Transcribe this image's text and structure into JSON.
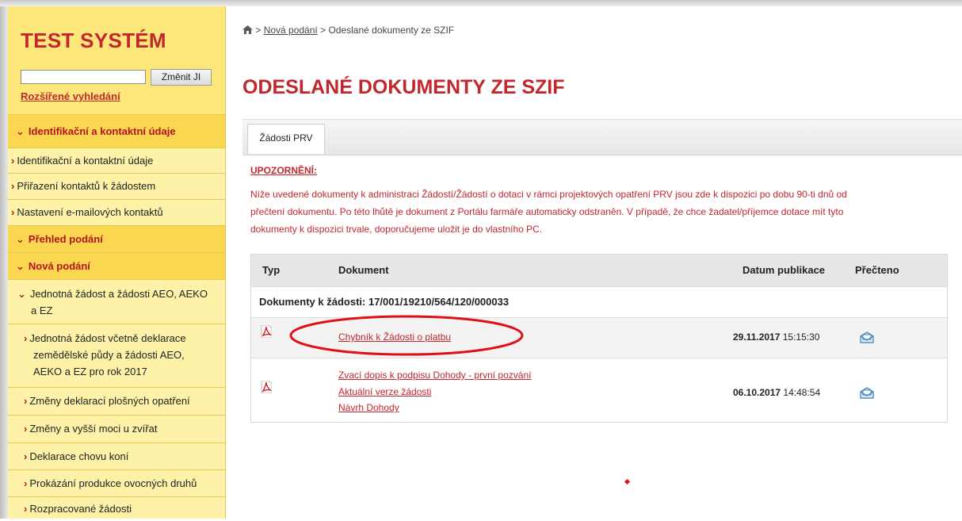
{
  "sidebar": {
    "brand": "TEST SYSTÉM",
    "search_value": "",
    "search_button": "Změnit JI",
    "advanced_search": "Rozšířené vyhledání",
    "items": [
      {
        "label": "Identifikační a kontaktní údaje",
        "kind": "section"
      },
      {
        "label": "Identifikační a kontaktní údaje",
        "kind": "item"
      },
      {
        "label": "Přiřazení kontaktů k žádostem",
        "kind": "item"
      },
      {
        "label": "Nastavení e-mailových kontaktů",
        "kind": "item"
      },
      {
        "label": "Přehled podání",
        "kind": "section"
      },
      {
        "label": "Nová podání",
        "kind": "section"
      },
      {
        "label_line1": "Jednotná žádost a žádosti AEO, AEKO",
        "label_line2": "a EZ",
        "kind": "subsection"
      },
      {
        "label_line1": "Jednotná žádost včetně deklarace",
        "label_line2": "zemědělské půdy a žádosti AEO,",
        "label_line3": "AEKO a EZ pro rok 2017",
        "kind": "subitem"
      },
      {
        "label": "Změny deklarací plošných opatření",
        "kind": "subitem"
      },
      {
        "label": "Změny a vyšší moci u zvířat",
        "kind": "subitem"
      },
      {
        "label": "Deklarace chovu koní",
        "kind": "subitem"
      },
      {
        "label": "Prokázání produkce ovocných druhů",
        "kind": "subitem"
      },
      {
        "label": "Rozpracované žádosti",
        "kind": "subitem"
      }
    ]
  },
  "breadcrumb": {
    "link": "Nová podání",
    "current": "Odeslané dokumenty ze SZIF"
  },
  "page_title": "ODESLANÉ DOKUMENTY ZE SZIF",
  "tab": "Žádosti PRV",
  "notice": {
    "heading": "UPOZORNĚNÍ:",
    "line1": "Níže uvedené dokumenty k administraci Žádostí/Žádostí o dotaci v rámci projektových opatření PRV jsou zde k dispozici po dobu 90-ti dnů od",
    "line2": "přečtení dokumentu. Po této lhůtě je dokument z Portálu farmáře automaticky odstraněn. V případě, že chce žadatel/příjemce dotace mít tyto",
    "line3": "dokumenty k dispozici trvale, doporučujeme uložit je do vlastního PC."
  },
  "table": {
    "headers": {
      "type": "Typ",
      "document": "Dokument",
      "date": "Datum publikace",
      "read": "Přečteno"
    },
    "group": "Dokumenty k žádosti: 17/001/19210/564/120/000033",
    "rows": [
      {
        "type_icon": "pdf-icon",
        "links": [
          "Chybník k Žádosti o platbu"
        ],
        "date": "29.11.2017",
        "time": "15:15:30",
        "read_icon": "envelope-open-icon"
      },
      {
        "type_icon": "pdf-icon",
        "links": [
          "Zvací dopis k podpisu Dohody - první pozvání",
          "Aktuální verze žádosti",
          "Návrh Dohody"
        ],
        "date": "06.10.2017",
        "time": "14:48:54",
        "read_icon": "envelope-open-icon"
      }
    ]
  },
  "colors": {
    "brand_red": "#c1272d",
    "sidebar_yellow": "#fde77a",
    "section_yellow": "#fbd651"
  }
}
